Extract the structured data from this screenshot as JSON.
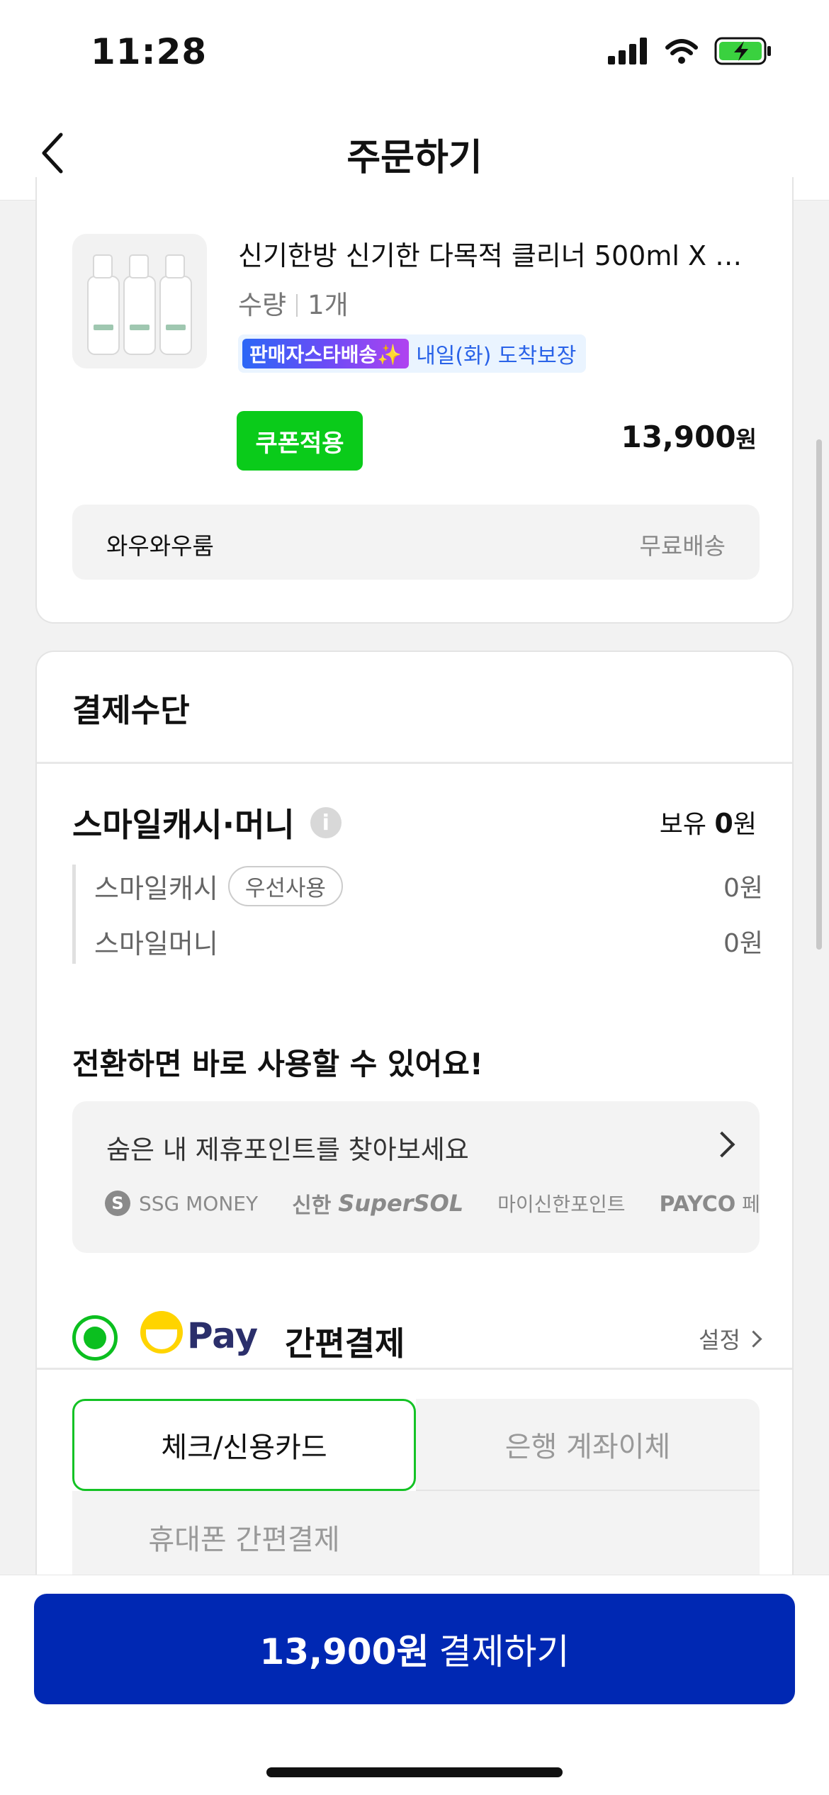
{
  "status_bar": {
    "time": "11:28"
  },
  "nav": {
    "title": "주문하기"
  },
  "product": {
    "name": "신기한방 신기한 다목적 클리너 500ml X …",
    "qty_label": "수량",
    "qty_value": "1개",
    "seller_badge": "판매자스타배송✨",
    "arrival": "내일(화) 도착보장",
    "coupon_label": "쿠폰적용",
    "price_amount": "13,900",
    "price_unit": "원",
    "shipping_store": "와우와우룸",
    "shipping_fee": "무료배송"
  },
  "payment": {
    "section_title": "결제수단",
    "smile_title": "스마일캐시·머니",
    "hold_label": "보유",
    "hold_value": "0",
    "hold_unit": "원",
    "rows": [
      {
        "label": "스마일캐시",
        "pill": "우선사용",
        "value": "0원"
      },
      {
        "label": "스마일머니",
        "value": "0원"
      }
    ],
    "convert_title": "전환하면 바로 사용할 수 있어요!",
    "partner_title": "숨은 내 제휴포인트를 찾아보세요",
    "partners": {
      "ssg": "SSG MONEY",
      "shinhan_a": "신한",
      "shinhan_b": "SuperSOL",
      "myshinhan": "마이신한포인트",
      "payco": "PAYCO",
      "payco_suffix": "페이코"
    },
    "pay_word": "Pay",
    "simple_pay_title": "간편결제",
    "settings_label": "설정",
    "tabs": [
      "체크/신용카드",
      "은행 계좌이체",
      "휴대폰 간편결제"
    ]
  },
  "checkout": {
    "amount": "13,900원",
    "label": "결제하기"
  }
}
